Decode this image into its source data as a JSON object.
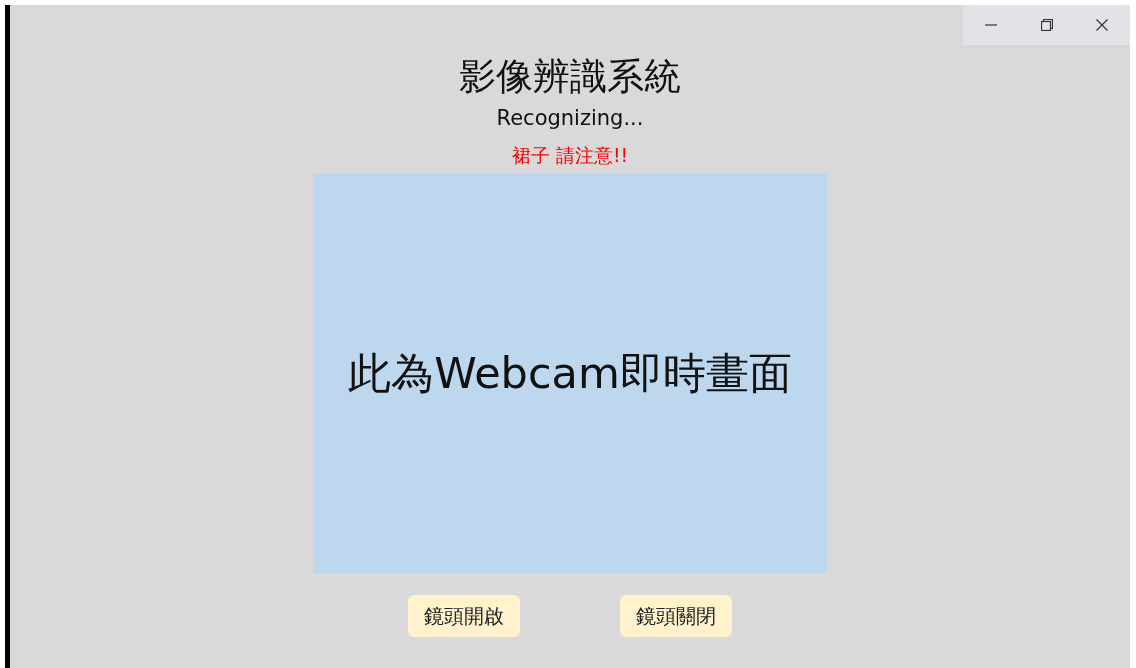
{
  "window": {
    "controls": [
      {
        "kind": "minimize"
      },
      {
        "kind": "maximize"
      },
      {
        "kind": "close"
      }
    ]
  },
  "title": "影像辨識系統",
  "status": "Recognizing...",
  "alert": "裙子 請注意!!",
  "webcam_panel": {
    "text": "此為Webcam即時畫面"
  },
  "buttons": [
    {
      "label": "鏡頭開啟"
    },
    {
      "label": "鏡頭關閉"
    }
  ]
}
